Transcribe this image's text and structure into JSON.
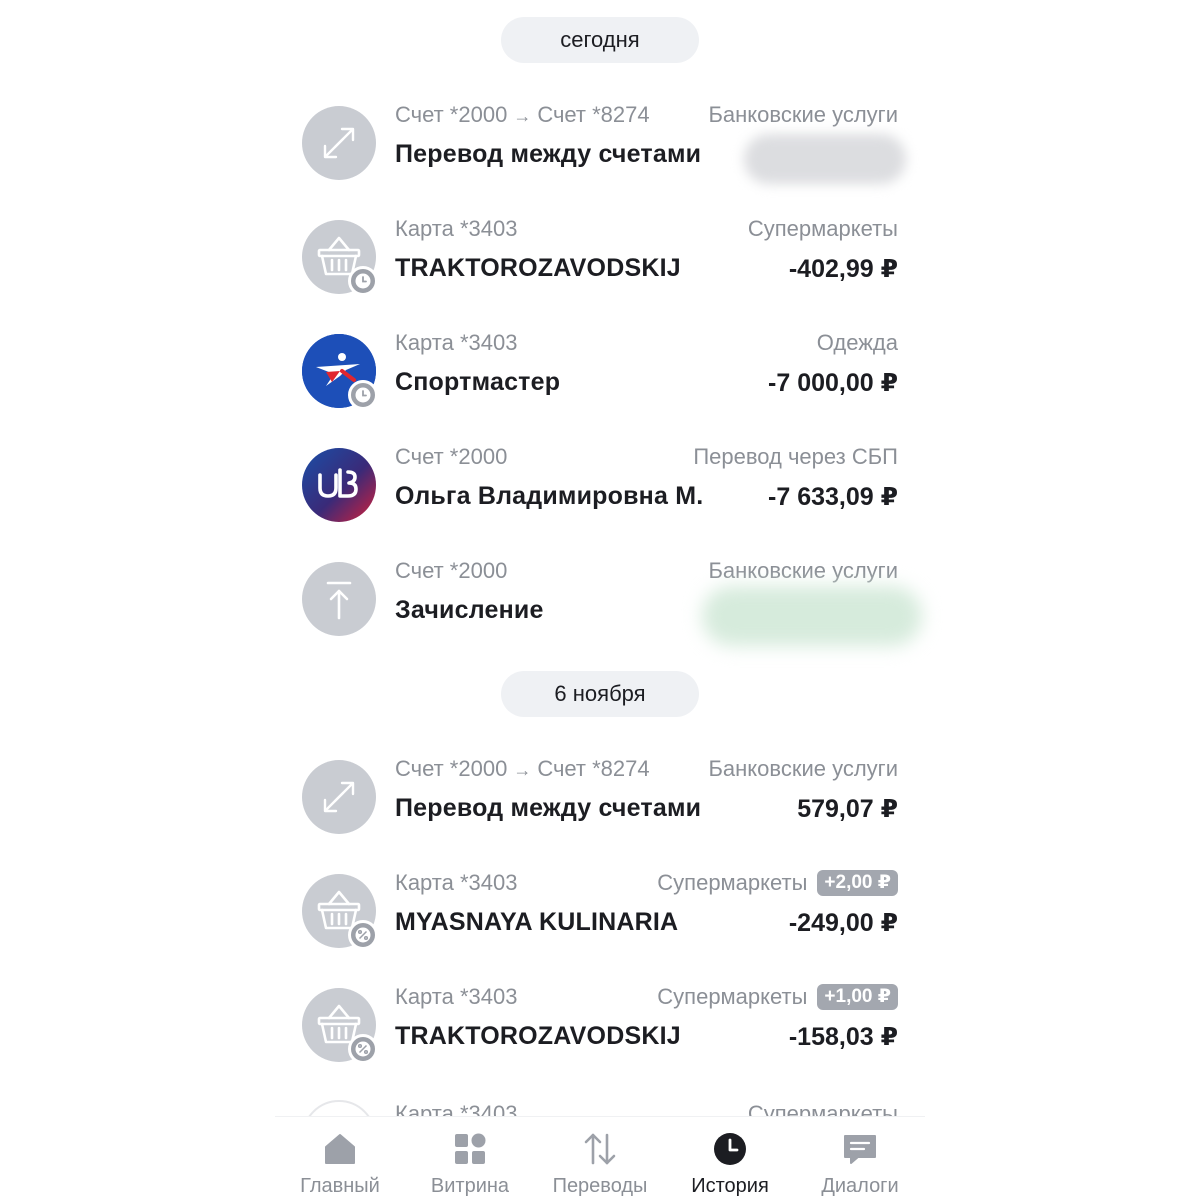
{
  "groups": [
    {
      "date": "сегодня",
      "items": [
        {
          "source": "Счет *2000",
          "arrow": "→",
          "target": "Счет *8274",
          "category": "Банковские услуги",
          "title": "Перевод между счетами",
          "amount": "",
          "icon": "transfer-arrows-icon"
        },
        {
          "source": "Карта *3403",
          "category": "Супермаркеты",
          "title": "TRAKTOROZAVODSKIJ",
          "amount": "-402,99 ₽",
          "icon": "basket-icon",
          "badge": "clock-icon"
        },
        {
          "source": "Карта *3403",
          "category": "Одежда",
          "title": "Спортмастер",
          "amount": "-7 000,00 ₽",
          "icon": "sportmaster-logo-icon",
          "badge": "clock-icon"
        },
        {
          "source": "Счет *2000",
          "category": "Перевод через СБП",
          "title": "Ольга Владимировна М.",
          "amount": "-7 633,09 ₽",
          "icon": "bank-logo-icon"
        },
        {
          "source": "Счет *2000",
          "category": "Банковские услуги",
          "title": "Зачисление",
          "amount": "",
          "icon": "upload-arrow-icon"
        }
      ]
    },
    {
      "date": "6 ноября",
      "items": [
        {
          "source": "Счет *2000",
          "arrow": "→",
          "target": "Счет *8274",
          "category": "Банковские услуги",
          "title": "Перевод между счетами",
          "amount": "579,07 ₽",
          "icon": "transfer-arrows-icon"
        },
        {
          "source": "Карта *3403",
          "category": "Супермаркеты",
          "bonus": "+2,00 ₽",
          "title": "MYASNAYA KULINARIA",
          "amount": "-249,00 ₽",
          "icon": "basket-icon",
          "badge": "percent-icon"
        },
        {
          "source": "Карта *3403",
          "category": "Супермаркеты",
          "bonus": "+1,00 ₽",
          "title": "TRAKTOROZAVODSKIJ",
          "amount": "-158,03 ₽",
          "icon": "basket-icon",
          "badge": "percent-icon"
        },
        {
          "source": "Карта *3403",
          "category": "Супермаркеты",
          "title": "",
          "amount": "",
          "icon": "store-logo-icon"
        }
      ]
    }
  ],
  "tabs": [
    {
      "label": "Главный",
      "icon": "home-icon",
      "active": false
    },
    {
      "label": "Витрина",
      "icon": "grid-icon",
      "active": false
    },
    {
      "label": "Переводы",
      "icon": "transfer-icon",
      "active": false
    },
    {
      "label": "История",
      "icon": "clock-icon",
      "active": true
    },
    {
      "label": "Диалоги",
      "icon": "chat-icon",
      "active": false
    }
  ],
  "colors": {
    "text": "#1c1d22",
    "muted": "#8b8f96",
    "icon_gray": "#c9ccd2",
    "pill": "#eff1f4",
    "bonus_badge": "#a3a7af",
    "sportmaster_blue": "#1d4fb8",
    "sportmaster_red": "#e0262f"
  }
}
